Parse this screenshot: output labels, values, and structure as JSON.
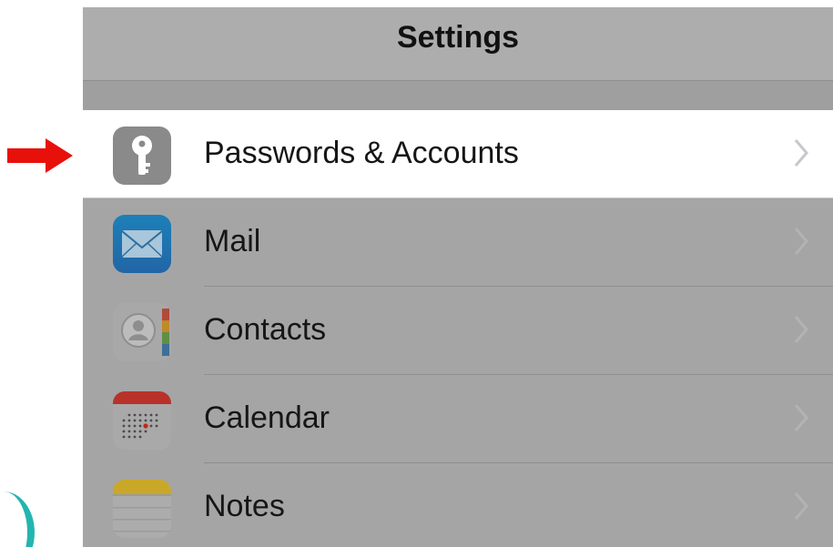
{
  "navbar": {
    "title": "Settings"
  },
  "rows": [
    {
      "label": "Passwords & Accounts",
      "icon": "key-icon",
      "highlighted": true
    },
    {
      "label": "Mail",
      "icon": "mail-icon",
      "highlighted": false
    },
    {
      "label": "Contacts",
      "icon": "contacts-icon",
      "highlighted": false
    },
    {
      "label": "Calendar",
      "icon": "calendar-icon",
      "highlighted": false
    },
    {
      "label": "Notes",
      "icon": "notes-icon",
      "highlighted": false
    }
  ],
  "annotation": {
    "arrow_color": "#e8100b",
    "points_to": "Passwords & Accounts"
  },
  "colors": {
    "highlight_row": "#ffffff",
    "dimmed_background": "#a5a5a5",
    "accent_teal": "#22b5b0"
  }
}
